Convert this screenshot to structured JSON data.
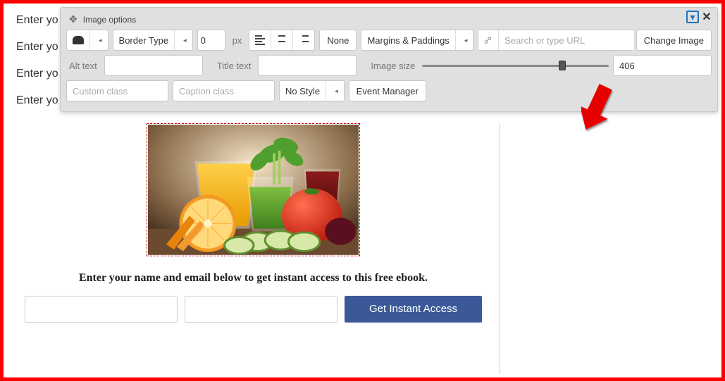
{
  "background": {
    "placeholderLines": [
      "Enter yo",
      "Enter yo",
      "Enter yo",
      "Enter yo"
    ]
  },
  "panel": {
    "title": "Image options",
    "row1": {
      "borderType": "Border Type",
      "borderWidthValue": "0",
      "borderUnit": "px",
      "floatNone": "None",
      "marginsPaddings": "Margins & Paddings",
      "urlPlaceholder": "Search or type URL",
      "changeImage": "Change Image"
    },
    "row2": {
      "altLabel": "Alt text",
      "titleLabel": "Title text",
      "sizeLabel": "Image size",
      "sizeValue": "406"
    },
    "row3": {
      "customClassPlaceholder": "Custom class",
      "captionClassPlaceholder": "Caption class",
      "noStyle": "No Style",
      "eventManager": "Event Manager"
    }
  },
  "content": {
    "heading": "Enter your name and email below to get instant access to this free ebook.",
    "cta": "Get Instant Access"
  }
}
